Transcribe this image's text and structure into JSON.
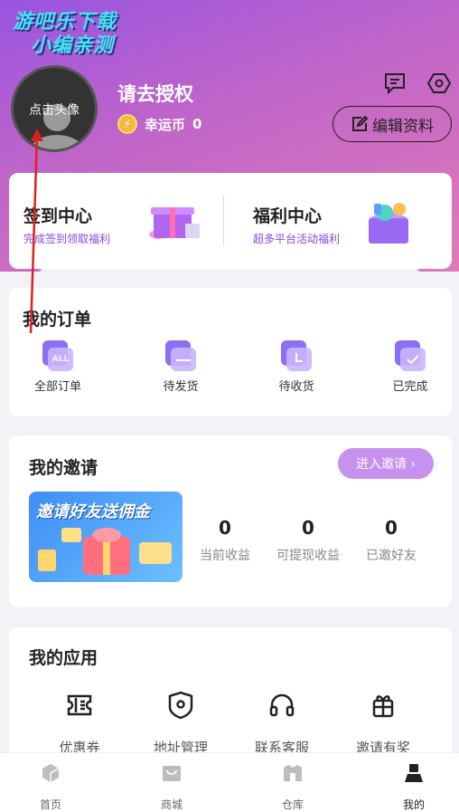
{
  "watermark": {
    "line1": "游吧乐下载",
    "line2": "小编亲测"
  },
  "profile": {
    "avatar_hint": "点击头像",
    "username": "请去授权",
    "coin_label": "幸运币",
    "coin_value": "0",
    "edit_label": "编辑资料"
  },
  "top_icons": [
    "message-icon",
    "settings-icon"
  ],
  "sign_card": {
    "left": {
      "title": "签到中心",
      "subtitle": "完成签到领取福利"
    },
    "right": {
      "title": "福利中心",
      "subtitle": "超多平台活动福利"
    }
  },
  "orders": {
    "title": "我的订单",
    "items": [
      {
        "label": "全部订单",
        "badge": "ALL",
        "icon": "all-orders-icon"
      },
      {
        "label": "待发货",
        "icon": "to-ship-icon"
      },
      {
        "label": "待收货",
        "icon": "to-receive-icon"
      },
      {
        "label": "已完成",
        "icon": "completed-icon"
      }
    ]
  },
  "invite": {
    "title": "我的邀请",
    "button": "进入邀请 ›",
    "banner_text": "邀请好友送佣金",
    "stats": [
      {
        "value": "0",
        "label": "当前收益"
      },
      {
        "value": "0",
        "label": "可提现收益"
      },
      {
        "value": "0",
        "label": "已邀好友"
      }
    ]
  },
  "apps": {
    "title": "我的应用",
    "items": [
      {
        "label": "优惠券",
        "icon": "coupon-icon"
      },
      {
        "label": "地址管理",
        "icon": "address-icon"
      },
      {
        "label": "联系客服",
        "icon": "headset-icon"
      },
      {
        "label": "邀请有奖",
        "icon": "gift-icon"
      }
    ]
  },
  "tabbar": {
    "items": [
      {
        "label": "首页",
        "icon": "home-icon"
      },
      {
        "label": "商城",
        "icon": "mall-icon"
      },
      {
        "label": "仓库",
        "icon": "warehouse-icon"
      },
      {
        "label": "我的",
        "icon": "profile-icon",
        "active": true
      }
    ]
  },
  "colors": {
    "accent": "#8b46e0",
    "header_start": "#9a54e0",
    "header_end": "#e07ab8",
    "invite_button": "#c791ee",
    "annotation_arrow": "#e02020"
  }
}
